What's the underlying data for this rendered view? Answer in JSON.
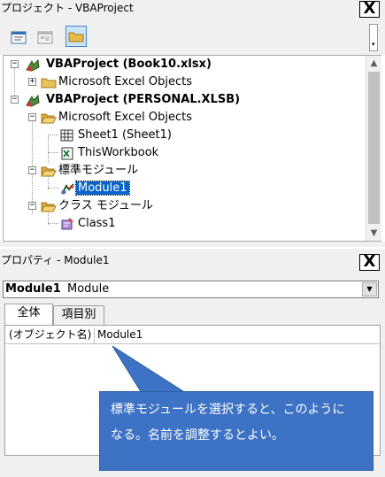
{
  "project": {
    "title": "プロジェクト - VBAProject",
    "close_label": "X",
    "toolbar": [
      {
        "name": "view-code-icon"
      },
      {
        "name": "view-object-icon"
      },
      {
        "name": "toggle-folders-icon"
      }
    ],
    "tree": [
      {
        "label": "VBAProject (Book10.xlsx)",
        "bold": true
      },
      {
        "label": "Microsoft Excel Objects"
      },
      {
        "label": "VBAProject (PERSONAL.XLSB)",
        "bold": true
      },
      {
        "label": "Microsoft Excel Objects"
      },
      {
        "label": "Sheet1 (Sheet1)"
      },
      {
        "label": "ThisWorkbook"
      },
      {
        "label": "標準モジュール"
      },
      {
        "label": "Module1",
        "selected": true
      },
      {
        "label": "クラス モジュール"
      },
      {
        "label": "Class1"
      }
    ]
  },
  "properties": {
    "title": "プロパティ - Module1",
    "close_label": "X",
    "object_name": "Module1",
    "object_type": "Module",
    "tabs": [
      "全体",
      "項目別"
    ],
    "rows": [
      {
        "name": "(オブジェクト名)",
        "value": "Module1"
      }
    ]
  },
  "callout": {
    "line1": "標準モジュールを選択すると、このように",
    "line2": "なる。名前を調整するとよい。"
  },
  "colors": {
    "selection": "#0a64c8",
    "callout": "#3d72c4",
    "chrome": "#f0f0f0"
  }
}
